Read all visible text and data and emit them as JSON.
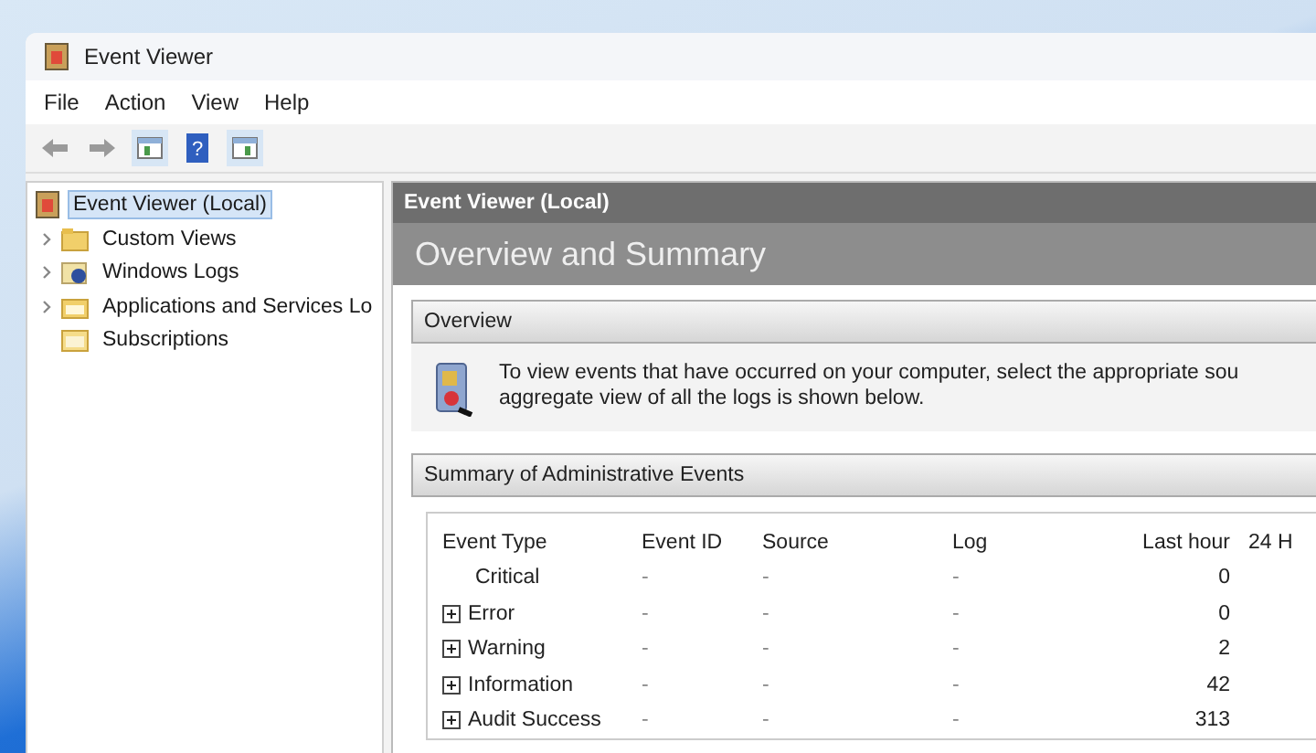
{
  "window": {
    "title": "Event Viewer"
  },
  "menu": [
    "File",
    "Action",
    "View",
    "Help"
  ],
  "toolbar": {
    "help": "?"
  },
  "tree": [
    {
      "label": "Event Viewer (Local)",
      "selected": true,
      "children": [
        {
          "label": "Custom Views",
          "selected": false,
          "expandable": true,
          "kind": "views"
        },
        {
          "label": "Windows Logs",
          "selected": false,
          "expandable": true,
          "kind": "logs"
        },
        {
          "label": "Applications and Services Lo",
          "selected": false,
          "expandable": true,
          "kind": "folder"
        },
        {
          "label": "Subscriptions",
          "selected": false,
          "expandable": false,
          "kind": "subs"
        }
      ]
    }
  ],
  "pane": {
    "header": "Event Viewer (Local)",
    "title": "Overview and Summary"
  },
  "overview": {
    "heading": "Overview",
    "lines": [
      "To view events that have occurred on your computer, select the appropriate sou",
      "aggregate view of all the logs is shown below."
    ]
  },
  "summary": {
    "heading": "Summary of Administrative Events",
    "columns": [
      "Event Type",
      "Event ID",
      "Source",
      "Log",
      "Last hour",
      "24 H"
    ],
    "rows": [
      {
        "event_type": "Critical",
        "expandable": false,
        "event_id": "-",
        "source": "-",
        "log": "-",
        "last_hour": "0"
      },
      {
        "event_type": "Error",
        "expandable": true,
        "event_id": "-",
        "source": "-",
        "log": "-",
        "last_hour": "0"
      },
      {
        "event_type": "Warning",
        "expandable": true,
        "event_id": "-",
        "source": "-",
        "log": "-",
        "last_hour": "2"
      },
      {
        "event_type": "Information",
        "expandable": true,
        "event_id": "-",
        "source": "-",
        "log": "-",
        "last_hour": "42"
      },
      {
        "event_type": "Audit Success",
        "expandable": true,
        "event_id": "-",
        "source": "-",
        "log": "-",
        "last_hour": "313"
      }
    ]
  }
}
